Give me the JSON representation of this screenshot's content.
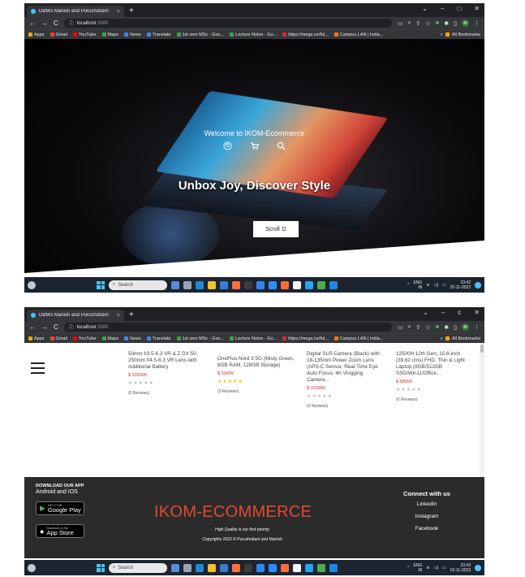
{
  "screenshot1": {
    "tab": {
      "title": "DBMS Manish and Purushottam",
      "close": "×",
      "new": "+"
    },
    "window": {
      "controls": [
        "⌄",
        "–",
        "□",
        "✕"
      ]
    },
    "address": {
      "url": "localhost",
      "port": ":3000"
    },
    "bookmarks": [
      "Apps",
      "Gmail",
      "YouTube",
      "Maps",
      "News",
      "Translate",
      "1st sem MSc - Goo...",
      "Lecture Notes - Go...",
      "https://mega.nz/fol...",
      "Campus LAN | India..."
    ],
    "bookmarks_all": "All Bookmarks",
    "hero": {
      "welcome": "Welcome to IKOM-Ecommerce",
      "tagline": "Unbox Joy, Discover Style",
      "scroll_label": "Scroll",
      "scroll_icon": "D"
    },
    "taskbar": {
      "search": "Search",
      "lang": "ENG",
      "region": "IN",
      "time": "23:42",
      "date": "02-11-2023"
    }
  },
  "screenshot2": {
    "tab": {
      "title": "DBMS Manish and Purushottam",
      "close": "×",
      "new": "+"
    },
    "window": {
      "controls": [
        "⌄",
        "–",
        "c",
        "✕"
      ]
    },
    "address": {
      "url": "localhost",
      "port": ":3000"
    },
    "bookmarks": [
      "Apps",
      "Gmail",
      "YouTube",
      "Maps",
      "News",
      "Translate",
      "1st sem MSc - Goo...",
      "Lecture Notes - Go...",
      "https://mega.nz/fol...",
      "Campus LAN | India..."
    ],
    "bookmarks_all": "All Bookmarks",
    "products": [
      {
        "name": "50mm f/3.5-6.3 VR & Z DX 50-250mm f/4.5-6.3 VR Lens with Additional Battery",
        "price": "$ 105995",
        "stars": "★★★★★",
        "rating": 0,
        "reviews": "(0 Reviews)"
      },
      {
        "name": "OnePlus Nord 3 5G (Misty Green, 8GB RAM, 128GB Storage)",
        "price": "$ 33499",
        "stars": "★★★★★",
        "rating": 4,
        "reviews": "(2 Reviews)"
      },
      {
        "name": "Digital SLR Camera (Black) with 18-135mm Power Zoom Lens (APS-C Sensor, Real-Time Eye Auto Focus, 4K Vlogging Camera...",
        "price": "$ 103990",
        "stars": "★★★★★",
        "rating": 0,
        "reviews": "(0 Reviews)"
      },
      {
        "name": "12500H 12th Gen, 15.6-inch (39.62 cms) FHD, Thin & Light Laptop (8GB/512GB SSD/Win11/Office...",
        "price": "$ 58999",
        "stars": "★★★★★",
        "rating": 0,
        "reviews": "(0 Reviews)"
      }
    ],
    "footer": {
      "download_heading": "DOWNLOAD OUR APP",
      "download_sub": "Android and IOS",
      "google_small": "GET IT ON",
      "google_big": "Google Play",
      "apple_small": "Download on the",
      "apple_big": "App Store",
      "brand": "IKOM-ECOMMERCE",
      "tagline": "High Quality is our first priority",
      "copyright": "Copyrights 2023 © Purushottam and Manish",
      "connect_heading": "Connect with us",
      "links": [
        "LinkedIn",
        "Instagram",
        "Facebook"
      ]
    },
    "taskbar": {
      "search": "Search",
      "lang": "ENG",
      "region": "IN",
      "time": "23:43",
      "date": "02-11-2023"
    }
  }
}
